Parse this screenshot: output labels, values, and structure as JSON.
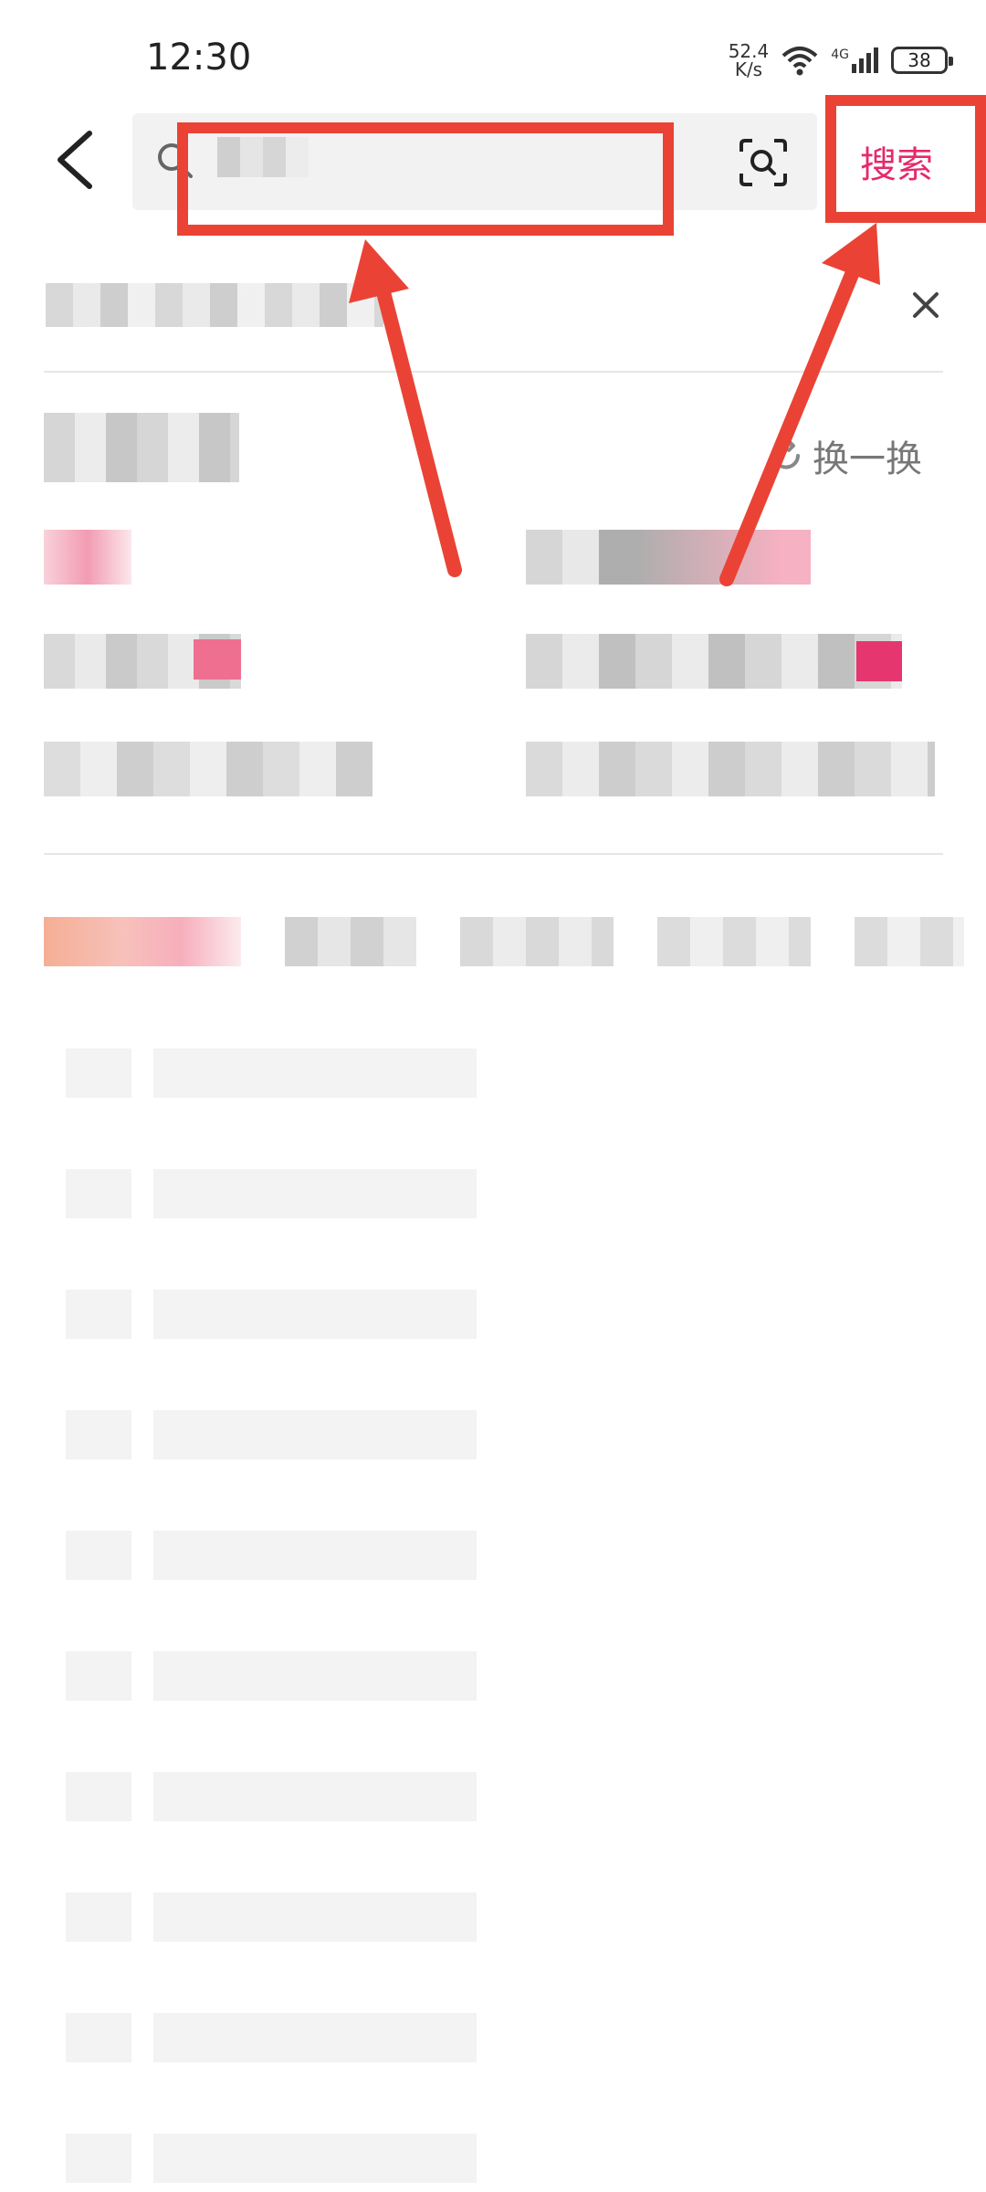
{
  "status_bar": {
    "time": "12:30",
    "net_speed_value": "52.4",
    "net_speed_unit": "K/s",
    "network_type": "4G",
    "battery": "38"
  },
  "search": {
    "search_button_label": "搜索"
  },
  "guess_section": {
    "refresh_label": "换一换"
  },
  "colors": {
    "accent": "#e6296b",
    "annotation": "#ea4335"
  },
  "icons": {
    "back": "back-arrow-icon",
    "search": "search-icon",
    "scan": "scan-icon",
    "close": "close-icon",
    "refresh": "refresh-icon"
  },
  "skeleton_rows": 10
}
